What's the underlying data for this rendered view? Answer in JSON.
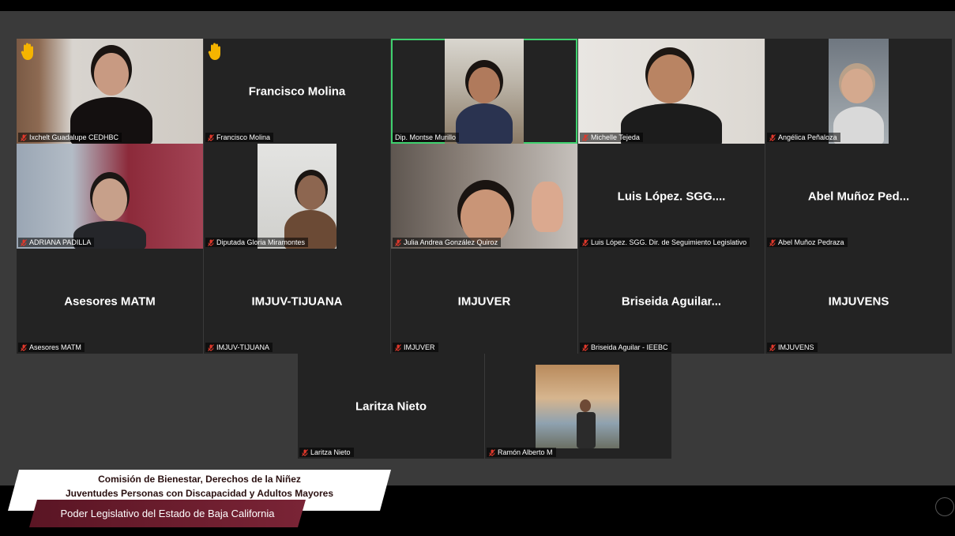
{
  "tiles": [
    {
      "id": "t1",
      "label": "Ixchelt Guadalupe CEDHBC",
      "hand_raised": true
    },
    {
      "id": "t2",
      "name": "Francisco Molina",
      "label": "Francisco Molina",
      "hand_raised": true
    },
    {
      "id": "t3",
      "label": "Dip. Montse Murillo",
      "active_speaker": true
    },
    {
      "id": "t4",
      "label": "Michelle Tejeda"
    },
    {
      "id": "t5",
      "label": "Angélica Peñaloza"
    },
    {
      "id": "t6",
      "label": "ADRIANA PADILLA"
    },
    {
      "id": "t7",
      "label": "Diputada Gloria Miramontes"
    },
    {
      "id": "t8",
      "label": "Julia Andrea González Quiroz"
    },
    {
      "id": "t9",
      "name": "Luis López. SGG....",
      "label": "Luis López. SGG. Dir. de Seguimiento Legislativo"
    },
    {
      "id": "t10",
      "name": "Abel Muñoz Ped...",
      "label": "Abel Muñoz Pedraza"
    },
    {
      "id": "t11",
      "name": "Asesores MATM",
      "label": "Asesores MATM"
    },
    {
      "id": "t12",
      "name": "IMJUV-TIJUANA",
      "label": "IMJUV-TIJUANA"
    },
    {
      "id": "t13",
      "name": "IMJUVER",
      "label": "IMJUVER"
    },
    {
      "id": "t14",
      "name": "Briseida Aguilar...",
      "label": "Briseida Aguilar - IEEBC"
    },
    {
      "id": "t15",
      "name": "IMJUVENS",
      "label": "IMJUVENS"
    },
    {
      "id": "t16",
      "name": "Laritza Nieto",
      "label": "Laritza Nieto"
    },
    {
      "id": "t17",
      "label": "Ramón Alberto M"
    }
  ],
  "banner": {
    "title_line1": "Comisión de Bienestar, Derechos de la Niñez",
    "title_line2": "Juventudes Personas con Discapacidad y Adultos Mayores",
    "subtitle": "Poder Legislativo del Estado de Baja California"
  },
  "colors": {
    "active_speaker": "#3fd16e",
    "mic_muted": "#e0382b",
    "hand_raised": "#f5b400",
    "banner_maroon": "#6a1c2d"
  }
}
